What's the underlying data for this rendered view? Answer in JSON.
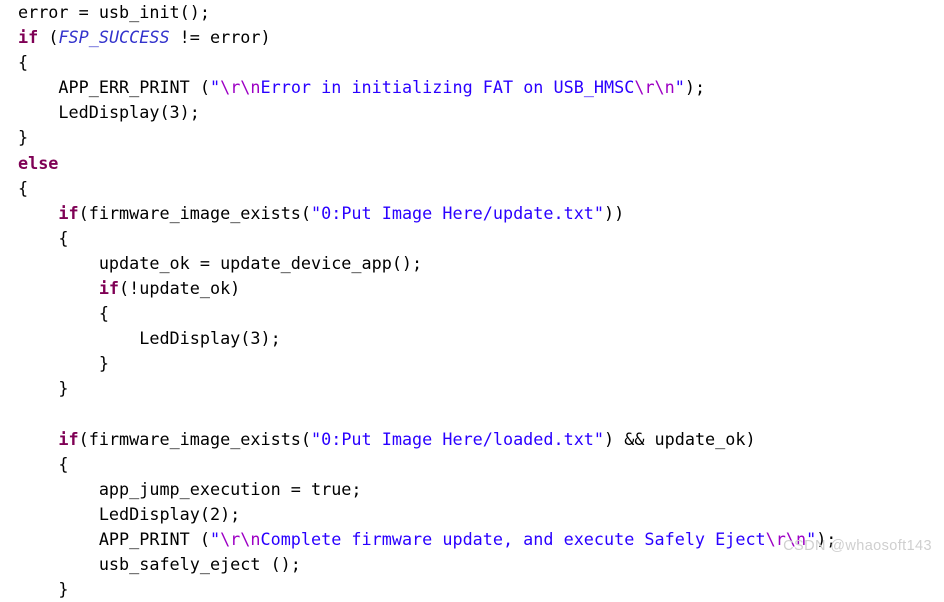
{
  "editor": {
    "language": "c",
    "background": "#ffffff",
    "colors": {
      "plain": "#000000",
      "keyword": "#7f0055",
      "macro": "#3333cc",
      "string": "#2a00ff",
      "escape": "#9d00c4",
      "watermark": "#cfcfcf"
    },
    "lines": [
      {
        "indent": 0,
        "tokens": [
          {
            "type": "plain",
            "text": "error = usb_init();"
          }
        ]
      },
      {
        "indent": 0,
        "tokens": [
          {
            "type": "keyword",
            "text": "if"
          },
          {
            "type": "plain",
            "text": " ("
          },
          {
            "type": "macro",
            "text": "FSP_SUCCESS"
          },
          {
            "type": "plain",
            "text": " != error)"
          }
        ]
      },
      {
        "indent": 0,
        "tokens": [
          {
            "type": "plain",
            "text": "{"
          }
        ]
      },
      {
        "indent": 1,
        "tokens": [
          {
            "type": "plain",
            "text": "APP_ERR_PRINT ("
          },
          {
            "type": "string",
            "text": "\""
          },
          {
            "type": "escape",
            "text": "\\r\\n"
          },
          {
            "type": "string",
            "text": "Error in initializing FAT on USB_HMSC"
          },
          {
            "type": "escape",
            "text": "\\r\\n"
          },
          {
            "type": "string",
            "text": "\""
          },
          {
            "type": "plain",
            "text": ");"
          }
        ]
      },
      {
        "indent": 1,
        "tokens": [
          {
            "type": "plain",
            "text": "LedDisplay(3);"
          }
        ]
      },
      {
        "indent": 0,
        "tokens": [
          {
            "type": "plain",
            "text": "}"
          }
        ]
      },
      {
        "indent": 0,
        "tokens": [
          {
            "type": "keyword",
            "text": "else"
          }
        ]
      },
      {
        "indent": 0,
        "tokens": [
          {
            "type": "plain",
            "text": "{"
          }
        ]
      },
      {
        "indent": 1,
        "tokens": [
          {
            "type": "keyword",
            "text": "if"
          },
          {
            "type": "plain",
            "text": "(firmware_image_exists("
          },
          {
            "type": "string",
            "text": "\"0:Put Image Here/update.txt\""
          },
          {
            "type": "plain",
            "text": "))"
          }
        ]
      },
      {
        "indent": 1,
        "tokens": [
          {
            "type": "plain",
            "text": "{"
          }
        ]
      },
      {
        "indent": 2,
        "tokens": [
          {
            "type": "plain",
            "text": "update_ok = update_device_app();"
          }
        ]
      },
      {
        "indent": 2,
        "tokens": [
          {
            "type": "keyword",
            "text": "if"
          },
          {
            "type": "plain",
            "text": "(!update_ok)"
          }
        ]
      },
      {
        "indent": 2,
        "tokens": [
          {
            "type": "plain",
            "text": "{"
          }
        ]
      },
      {
        "indent": 3,
        "tokens": [
          {
            "type": "plain",
            "text": "LedDisplay(3);"
          }
        ]
      },
      {
        "indent": 2,
        "tokens": [
          {
            "type": "plain",
            "text": "}"
          }
        ]
      },
      {
        "indent": 1,
        "tokens": [
          {
            "type": "plain",
            "text": "}"
          }
        ]
      },
      {
        "indent": 0,
        "tokens": []
      },
      {
        "indent": 1,
        "tokens": [
          {
            "type": "keyword",
            "text": "if"
          },
          {
            "type": "plain",
            "text": "(firmware_image_exists("
          },
          {
            "type": "string",
            "text": "\"0:Put Image Here/loaded.txt\""
          },
          {
            "type": "plain",
            "text": ") && update_ok)"
          }
        ]
      },
      {
        "indent": 1,
        "tokens": [
          {
            "type": "plain",
            "text": "{"
          }
        ]
      },
      {
        "indent": 2,
        "tokens": [
          {
            "type": "plain",
            "text": "app_jump_execution = true;"
          }
        ]
      },
      {
        "indent": 2,
        "tokens": [
          {
            "type": "plain",
            "text": "LedDisplay(2);"
          }
        ]
      },
      {
        "indent": 2,
        "tokens": [
          {
            "type": "plain",
            "text": "APP_PRINT ("
          },
          {
            "type": "string",
            "text": "\""
          },
          {
            "type": "escape",
            "text": "\\r\\n"
          },
          {
            "type": "string",
            "text": "Complete firmware update, and execute Safely Eject"
          },
          {
            "type": "escape",
            "text": "\\r\\n"
          },
          {
            "type": "string",
            "text": "\""
          },
          {
            "type": "plain",
            "text": ");"
          }
        ]
      },
      {
        "indent": 2,
        "tokens": [
          {
            "type": "plain",
            "text": "usb_safely_eject ();"
          }
        ]
      },
      {
        "indent": 1,
        "tokens": [
          {
            "type": "plain",
            "text": "}"
          }
        ]
      }
    ]
  },
  "watermark": {
    "text": "CSDN @whaosoft143"
  }
}
